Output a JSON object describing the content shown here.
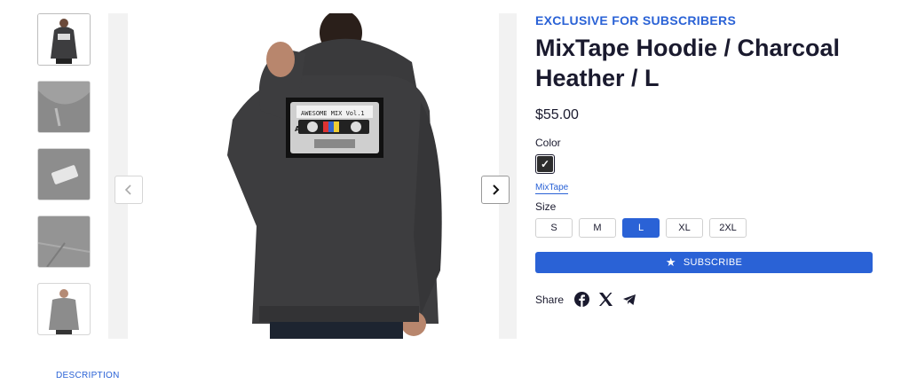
{
  "product": {
    "eyebrow": "EXCLUSIVE FOR SUBSCRIBERS",
    "title_line1": "MixTape Hoodie / Charcoal",
    "title_line2": "Heather / L",
    "price": "$55.00",
    "color_label": "Color",
    "color_swatch_check": "✓",
    "collection_link": "MixTape",
    "size_label": "Size",
    "sizes": [
      "S",
      "M",
      "L",
      "XL",
      "2XL"
    ],
    "selected_size": "L",
    "subscribe_label": "SUBSCRIBE",
    "share_label": "Share"
  },
  "artwork": {
    "tape_text": "AWESOME MIX Vol.1",
    "tape_side": "A"
  },
  "tabs": {
    "description": "DESCRIPTION"
  },
  "colors": {
    "accent": "#2a62d6",
    "hoodie": "#3d3d3f",
    "text": "#1a1a2e"
  }
}
